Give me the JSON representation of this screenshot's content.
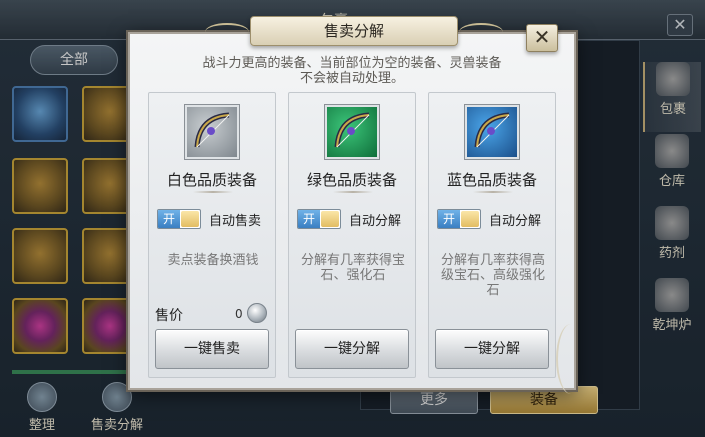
{
  "background": {
    "title": "包裹",
    "close_symbol": "✕",
    "tab_all": "全部",
    "bottom_buttons": [
      {
        "label": "整理",
        "icon": "sort-icon"
      },
      {
        "label": "售卖分解",
        "icon": "gear-icon"
      }
    ],
    "side_nav": [
      {
        "label": "包裹",
        "icon": "bag-icon"
      },
      {
        "label": "仓库",
        "icon": "warehouse-icon"
      },
      {
        "label": "药剂",
        "icon": "potion-icon"
      },
      {
        "label": "乾坤炉",
        "icon": "furnace-icon"
      }
    ],
    "more_button": "更多",
    "equip_button": "装备"
  },
  "modal": {
    "title": "售卖分解",
    "close_symbol": "✕",
    "description_line1": "战斗力更高的装备、当前部位为空的装备、灵兽装备",
    "description_line2": "不会被自动处理。",
    "cards": [
      {
        "quality": "white",
        "icon": "bow-icon",
        "name": "白色品质装备",
        "toggle_text": "开",
        "toggle_state": "on",
        "toggle_label": "自动售卖",
        "info": "卖点装备换酒钱",
        "price_label": "售价",
        "price_value": "0",
        "price_icon": "silver-coin-icon",
        "button_label": "一键售卖"
      },
      {
        "quality": "green",
        "icon": "bow-icon",
        "name": "绿色品质装备",
        "toggle_text": "开",
        "toggle_state": "on",
        "toggle_label": "自动分解",
        "info": "分解有几率获得宝石、强化石",
        "button_label": "一键分解"
      },
      {
        "quality": "blue",
        "icon": "bow-icon",
        "name": "蓝色品质装备",
        "toggle_text": "开",
        "toggle_state": "on",
        "toggle_label": "自动分解",
        "info": "分解有几率获得高级宝石、高级强化石",
        "button_label": "一键分解"
      }
    ]
  }
}
